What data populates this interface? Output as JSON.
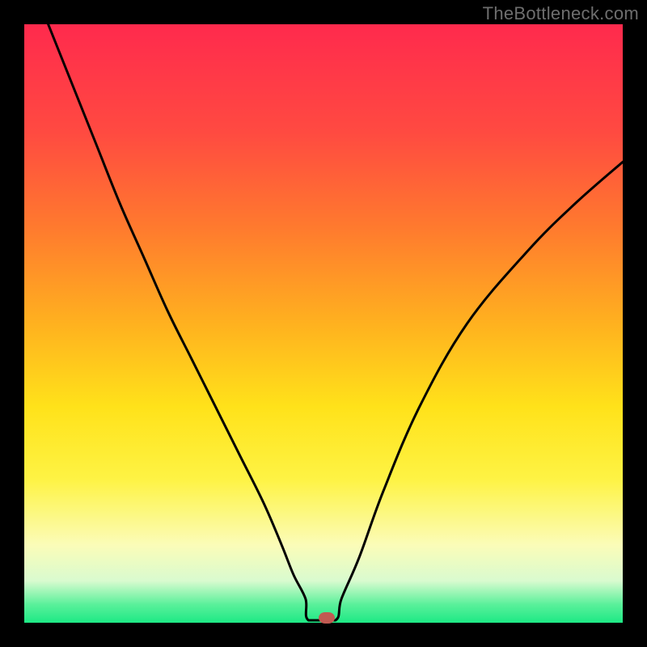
{
  "watermark": "TheBottleneck.com",
  "colors": {
    "frame": "#000000",
    "curve": "#000000",
    "marker": "#c15a52"
  },
  "chart_data": {
    "type": "line",
    "title": "",
    "xlabel": "",
    "ylabel": "",
    "xlim": [
      0,
      100
    ],
    "ylim": [
      0,
      100
    ],
    "grid": false,
    "series": [
      {
        "name": "bottleneck-curve",
        "x": [
          0,
          4,
          8,
          12,
          16,
          20,
          24,
          28,
          32,
          36,
          40,
          43,
          45,
          47,
          48.5,
          50,
          51.5,
          53,
          56,
          60,
          66,
          74,
          84,
          92,
          100
        ],
        "y": [
          110,
          100,
          90,
          80,
          70,
          61,
          52,
          44,
          36,
          28,
          20,
          13,
          8,
          4,
          1.5,
          0.5,
          1.5,
          4,
          11,
          22,
          36,
          50,
          62,
          70,
          77
        ]
      }
    ],
    "flat_segment": {
      "x": [
        47.5,
        52
      ],
      "y": 0.4
    },
    "marker": {
      "x": 50.5,
      "y": 0.8
    },
    "background_gradient": [
      {
        "stop": 0.0,
        "color": "#ff2a4d"
      },
      {
        "stop": 0.18,
        "color": "#ff4a41"
      },
      {
        "stop": 0.34,
        "color": "#ff7a2e"
      },
      {
        "stop": 0.5,
        "color": "#ffb11f"
      },
      {
        "stop": 0.64,
        "color": "#ffe21a"
      },
      {
        "stop": 0.76,
        "color": "#fef344"
      },
      {
        "stop": 0.87,
        "color": "#fbfcb8"
      },
      {
        "stop": 0.93,
        "color": "#d9fbcf"
      },
      {
        "stop": 0.97,
        "color": "#59f09a"
      },
      {
        "stop": 1.0,
        "color": "#1de985"
      }
    ]
  }
}
